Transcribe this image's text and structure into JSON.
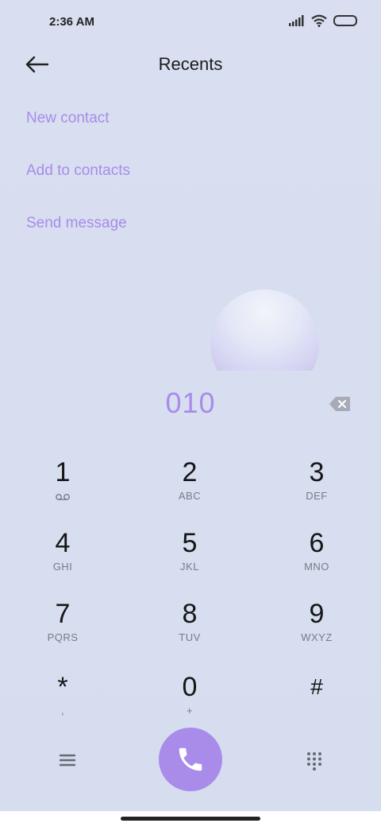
{
  "status_bar": {
    "time": "2:36 AM"
  },
  "header": {
    "title": "Recents"
  },
  "actions": [
    {
      "label": "New contact"
    },
    {
      "label": "Add to contacts"
    },
    {
      "label": "Send message"
    }
  ],
  "dialed_number": "010",
  "keypad": [
    {
      "digit": "1",
      "letters": ""
    },
    {
      "digit": "2",
      "letters": "ABC"
    },
    {
      "digit": "3",
      "letters": "DEF"
    },
    {
      "digit": "4",
      "letters": "GHI"
    },
    {
      "digit": "5",
      "letters": "JKL"
    },
    {
      "digit": "6",
      "letters": "MNO"
    },
    {
      "digit": "7",
      "letters": "PQRS"
    },
    {
      "digit": "8",
      "letters": "TUV"
    },
    {
      "digit": "9",
      "letters": "WXYZ"
    },
    {
      "digit": "*",
      "letters": ","
    },
    {
      "digit": "0",
      "letters": "+"
    },
    {
      "digit": "#",
      "letters": ""
    }
  ],
  "icons": {
    "back": "back-arrow-icon",
    "backspace": "backspace-icon",
    "voicemail": "voicemail-icon",
    "menu": "menu-icon",
    "call": "phone-icon",
    "dialpad": "dialpad-icon"
  },
  "colors": {
    "accent": "#a98bea",
    "background": "#d8def0"
  }
}
